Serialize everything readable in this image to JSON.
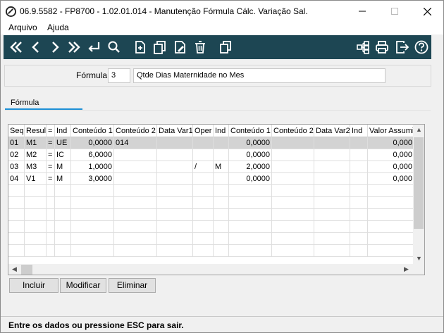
{
  "window": {
    "title": "06.9.5582 - FP8700 - 1.02.01.014 - Manutenção Fórmula Cálc. Variação Sal."
  },
  "menu": {
    "items": [
      "Arquivo",
      "Ajuda"
    ]
  },
  "toolbar": {
    "icons": [
      "first-icon",
      "previous-icon",
      "next-icon",
      "last-icon",
      "return-icon",
      "search-icon",
      "new-icon",
      "copy-icon",
      "edit-icon",
      "delete-icon",
      "duplicate-icon",
      "tree-icon",
      "print-icon",
      "exit-icon",
      "help-icon"
    ]
  },
  "form": {
    "formula_label": "Fórmula:",
    "formula_code": "3",
    "formula_description": "Qtde Dias  Maternidade no Mes"
  },
  "tabs": [
    {
      "label": "Fórmula"
    }
  ],
  "grid": {
    "columns": [
      "Seq",
      "Resul",
      "=",
      "Ind",
      "Conteúdo 1",
      "Conteúdo 2",
      "Data Var1",
      "Oper",
      "Ind",
      "Conteúdo 1",
      "Conteúdo 2",
      "Data Var2",
      "Ind",
      "Valor Assumi"
    ],
    "rows": [
      [
        "01",
        "M1",
        "=",
        "UE",
        "0,0000",
        "014",
        "",
        "",
        "",
        "0,0000",
        "",
        "",
        "",
        "0,000"
      ],
      [
        "02",
        "M2",
        "=",
        "IC",
        "6,0000",
        "",
        "",
        "",
        "",
        "0,0000",
        "",
        "",
        "",
        "0,000"
      ],
      [
        "03",
        "M3",
        "=",
        "M",
        "1,0000",
        "",
        "",
        "/",
        "M",
        "2,0000",
        "",
        "",
        "",
        "0,000"
      ],
      [
        "04",
        "V1",
        "=",
        "M",
        "3,0000",
        "",
        "",
        "",
        "",
        "0,0000",
        "",
        "",
        "",
        "0,000"
      ]
    ]
  },
  "buttons": {
    "include": "Incluir",
    "modify": "Modificar",
    "delete": "Eliminar"
  },
  "status": {
    "message": "Entre os dados ou pressione ESC para sair."
  },
  "colors": {
    "toolbar_bg": "#1d4653",
    "tab_accent": "#1c8fd6",
    "selected_row": "#d3d3d3"
  }
}
